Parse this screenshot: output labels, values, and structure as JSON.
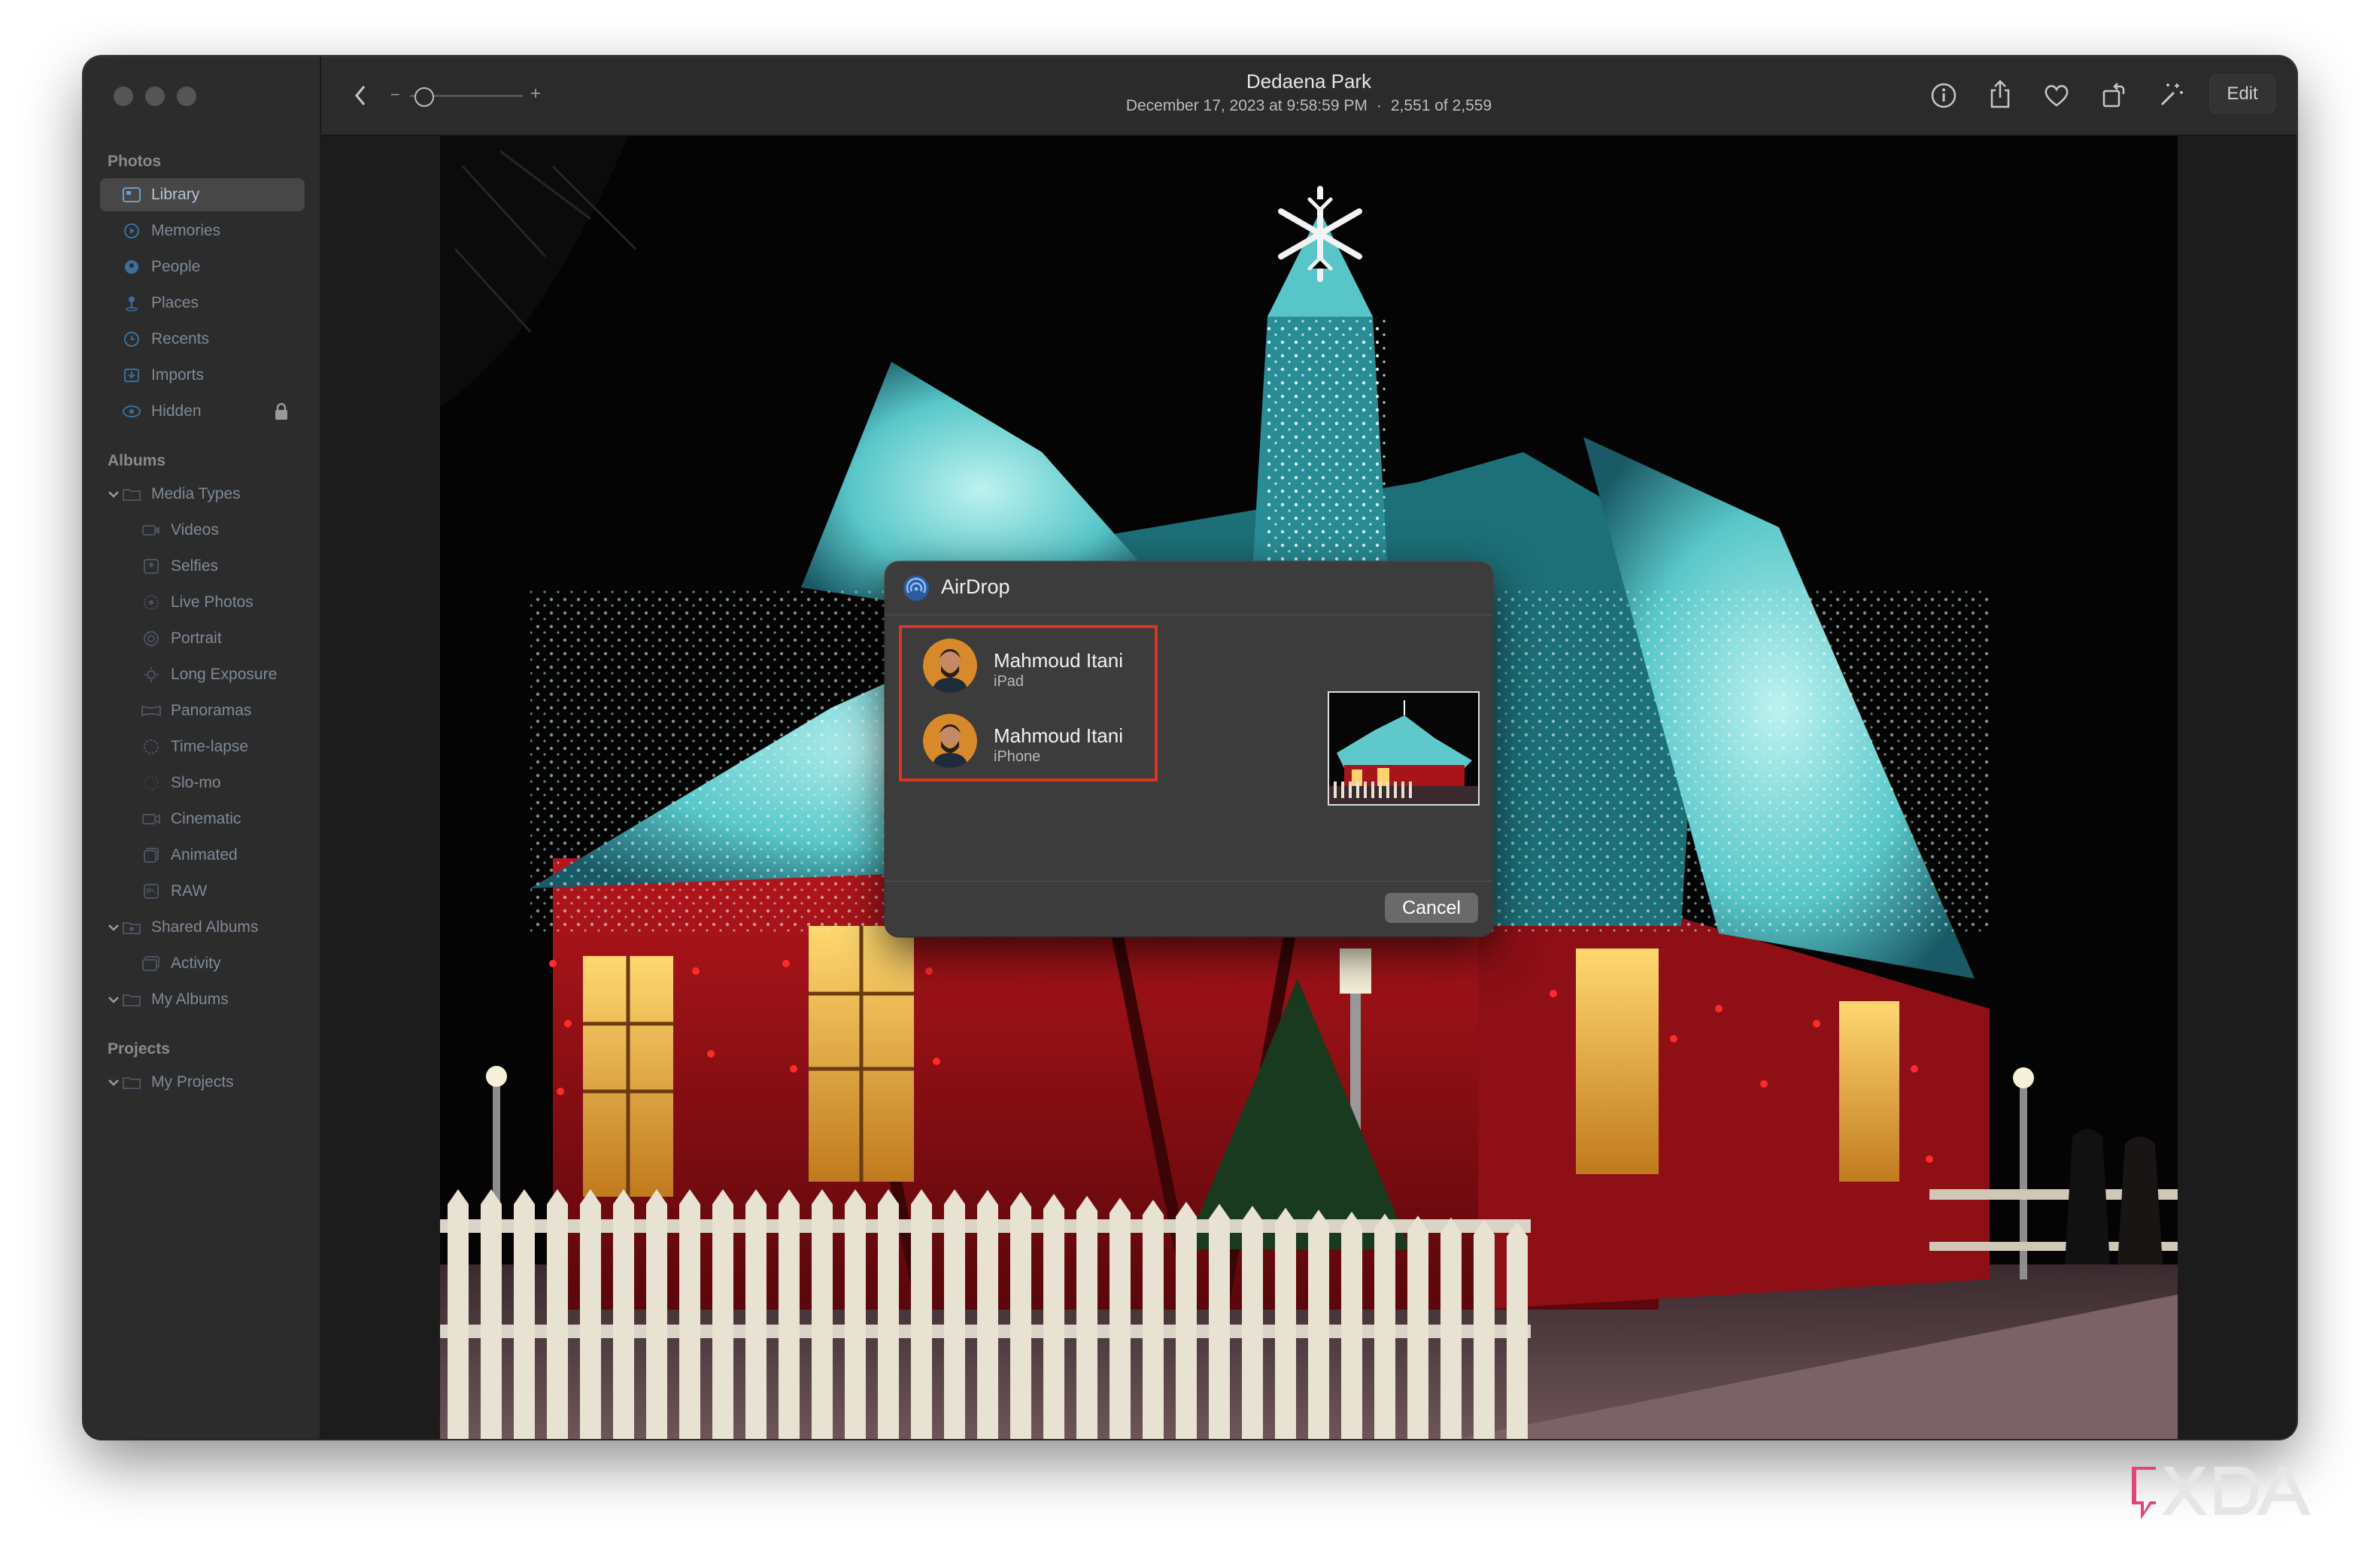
{
  "sidebar": {
    "sections": {
      "photos": "Photos",
      "albums": "Albums",
      "projects": "Projects"
    },
    "photos_items": [
      {
        "label": "Library",
        "icon": "library-icon",
        "selected": true
      },
      {
        "label": "Memories",
        "icon": "memories-icon"
      },
      {
        "label": "People",
        "icon": "people-icon"
      },
      {
        "label": "Places",
        "icon": "places-icon"
      },
      {
        "label": "Recents",
        "icon": "recents-icon"
      },
      {
        "label": "Imports",
        "icon": "imports-icon"
      },
      {
        "label": "Hidden",
        "icon": "hidden-icon",
        "locked": true
      }
    ],
    "albums_items": [
      {
        "label": "Media Types",
        "icon": "folder-icon",
        "expanded": true
      },
      {
        "label": "Videos",
        "icon": "video-icon"
      },
      {
        "label": "Selfies",
        "icon": "selfie-icon"
      },
      {
        "label": "Live Photos",
        "icon": "live-photo-icon"
      },
      {
        "label": "Portrait",
        "icon": "portrait-icon"
      },
      {
        "label": "Long Exposure",
        "icon": "long-exposure-icon"
      },
      {
        "label": "Panoramas",
        "icon": "panorama-icon"
      },
      {
        "label": "Time-lapse",
        "icon": "time-lapse-icon"
      },
      {
        "label": "Slo-mo",
        "icon": "slo-mo-icon"
      },
      {
        "label": "Cinematic",
        "icon": "cinematic-icon"
      },
      {
        "label": "Animated",
        "icon": "animated-icon"
      },
      {
        "label": "RAW",
        "icon": "raw-icon"
      },
      {
        "label": "Shared Albums",
        "icon": "shared-albums-icon",
        "expanded": true
      },
      {
        "label": "Activity",
        "icon": "activity-icon"
      },
      {
        "label": "My Albums",
        "icon": "folder-icon",
        "expanded": true
      }
    ],
    "projects_items": [
      {
        "label": "My Projects",
        "icon": "folder-icon",
        "expanded": true
      }
    ]
  },
  "toolbar": {
    "title": "Dedaena Park",
    "date": "December 17, 2023 at 9:58:59 PM",
    "separator": "·",
    "count": "2,551 of 2,559",
    "zoom_minus": "−",
    "zoom_plus": "+",
    "zoom_level": 0.05,
    "edit_label": "Edit"
  },
  "airdrop": {
    "title": "AirDrop",
    "devices": [
      {
        "name": "Mahmoud Itani",
        "type": "iPad"
      },
      {
        "name": "Mahmoud Itani",
        "type": "iPhone"
      }
    ],
    "cancel_label": "Cancel"
  },
  "colors": {
    "highlight": "#e0321e",
    "sidebar_text": "#7f8a97",
    "window_bg": "#1e1e1e"
  }
}
